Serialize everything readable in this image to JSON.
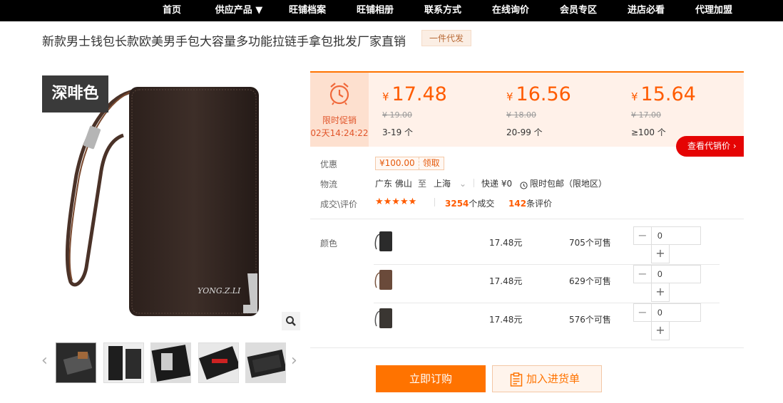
{
  "nav": {
    "items": [
      "首页",
      "供应产品 ▼",
      "旺铺档案",
      "旺铺相册",
      "联系方式",
      "在线询价",
      "会员专区",
      "进店必看",
      "代理加盟"
    ]
  },
  "product": {
    "title": "新款男士钱包长款欧美男手包大容量多功能拉链手拿包批发厂家直销",
    "tag": "一件代发",
    "color_label": "深啡色",
    "brand_text": "YONG.Z.LI"
  },
  "gallery": {
    "prev_arrow": "‹",
    "next_arrow": "›",
    "zoom_icon": "magnifier-icon"
  },
  "promo": {
    "label": "限时促销",
    "countdown": "02天14:24:22",
    "icon": "alarm-clock-icon"
  },
  "tiers": [
    {
      "currency": "¥",
      "price": "17.48",
      "old_price": "¥ 19.00",
      "quantity": "3-19 个"
    },
    {
      "currency": "¥",
      "price": "16.56",
      "old_price": "¥ 18.00",
      "quantity": "20-99 个"
    },
    {
      "currency": "¥",
      "price": "15.64",
      "old_price": "¥ 17.00",
      "quantity": "≥100 个"
    }
  ],
  "agent_button": "查看代销价 ›",
  "discount": {
    "label": "优惠",
    "coupon_value": "¥100.00",
    "coupon_action": "领取"
  },
  "logistics": {
    "label": "物流",
    "from": "广东 佛山",
    "to_word": "至",
    "to": "上海",
    "express": "快递 ¥0",
    "free_ship": "限时包邮（限地区）"
  },
  "deals": {
    "label": "成交\\评价",
    "rating": 5,
    "stars": "★★★★★",
    "sold_count": "3254",
    "sold_label": "个成交",
    "review_count": "142",
    "review_label": "条评价"
  },
  "sku": {
    "label": "颜色",
    "rows": [
      {
        "price": "17.48元",
        "stock": "705个可售",
        "quantity": "0",
        "color": "#2b2b2b"
      },
      {
        "price": "17.48元",
        "stock": "629个可售",
        "quantity": "0",
        "color": "#6a4a3a"
      },
      {
        "price": "17.48元",
        "stock": "576个可售",
        "quantity": "0",
        "color": "#3a3632"
      }
    ],
    "minus": "−",
    "plus": "+"
  },
  "actions": {
    "order": "立即订购",
    "cart": "加入进货单"
  },
  "colors": {
    "accent": "#ff7300",
    "price": "#ff5b00",
    "red_button": "#e50404"
  }
}
